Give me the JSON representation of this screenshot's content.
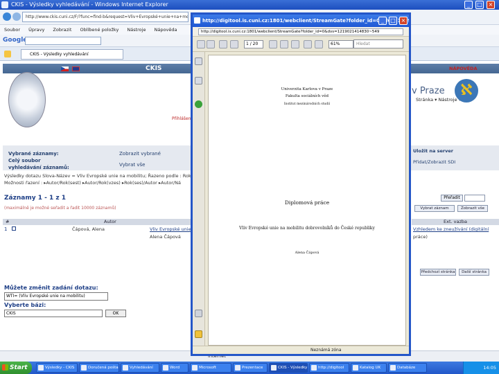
{
  "ie": {
    "title": "CKIS - Výsledky vyhledávání - Windows Internet Explorer",
    "address": "http://www.ckis.cuni.cz/F/?func=find-b&request=Vliv+Evropské+unie+na+mobilitu&find_code=WRD",
    "menu": [
      "Soubor",
      "Úpravy",
      "Zobrazit",
      "Oblíbené položky",
      "Nástroje",
      "Nápověda"
    ],
    "google": "Google",
    "tab_label": "CKIS - Výsledky vyhledávání",
    "right_tools": "Stránka ▾  Nástroje ▾",
    "status": "Internet",
    "caption_buttons": [
      "_",
      "□",
      "×"
    ]
  },
  "ckis": {
    "title": "CKIS",
    "help": "NÁPOVĚDA",
    "praze": "v Praze",
    "logo_letter": "ℵ",
    "login": "Přihlášení"
  },
  "results": {
    "left_labels": [
      "Vybrané záznamy:",
      "Celý soubor",
      "vyhledávání záznamů:"
    ],
    "mid_labels": [
      "Zobrazit vybrané",
      "Vybrat vše"
    ],
    "query_line1": "Výsledky dotazu Slova-Název = Vliv Evropské unie na mobilitu; Řazeno podle : Rok",
    "query_line2": "Možnosti řazení : ▸Autor/Rok(sest) ▸Autor/Rok(vzes) ▸Rok(ses)/Autor ▸Autor/Ná",
    "records_label": "Záznamy 1 - 1 z 1",
    "max_note": "(maximálně je možné seřadit a řadit 10000 záznamů)",
    "col_hash": "#",
    "col_author": "Autor",
    "row_num": "1",
    "row_author": "Čápová, Alena",
    "row_title": "Vliv Evropské unie na",
    "row_title2": "Alena Čápová",
    "right_labels": [
      "Uložit na server",
      "Přidat/Zobrazit SDI"
    ],
    "pretrad": "Přeřadit",
    "rbtn1": "Vybrat záznam",
    "rbtn2": "Zobrazit vše",
    "ext_head": "Ext. vazba",
    "ext_link": "Vzhledem ke zneužívání (digitální",
    "ext_link2": "práce)",
    "pager1": "Předchozí stránka",
    "pager2": "Další stránka",
    "change_query": "Můžete změnit zadání dotazu:",
    "query_value": "WTI= (Vliv Evropské unie na mobilitu)",
    "choose_base": "Vyberte bázi:",
    "base_value": "CKIS",
    "ok": "OK"
  },
  "pdf": {
    "title": "http://digitool.is.cuni.cz:1801/webclient/StreamGate?folder_id=0&dvs=1219021414830~549...",
    "address": "http://digitool.is.cuni.cz:1801/webclient/StreamGate?folder_id=0&dvs=1219021414830~549",
    "page_value": "1  / 20",
    "zoom_value": "61%",
    "find_placeholder": "Hledat",
    "status": "Neznámá zóna",
    "university": "Univerzita Karlova v Praze",
    "faculty": "Fakulta sociálních věd",
    "institute": "Institut mezinárodních studií",
    "doc_type": "Diplomová práce",
    "doc_title": "Vliv Evropské unie na mobilitu dobrovolníků do České republiky",
    "doc_author": "Alena Čápová"
  },
  "taskbar": {
    "start": "Start",
    "items": [
      {
        "label": "Výsledky - CKIS"
      },
      {
        "label": "Doručená pošta"
      },
      {
        "label": "Vyhledávání"
      },
      {
        "label": "Word"
      },
      {
        "label": "Microsoft"
      },
      {
        "label": "Prezentace"
      },
      {
        "label": "CKIS - Výsledky",
        "active": true
      },
      {
        "label": "http://digitool"
      },
      {
        "label": "Katalog UK"
      },
      {
        "label": "Databáze"
      }
    ],
    "clock": "14:05"
  }
}
